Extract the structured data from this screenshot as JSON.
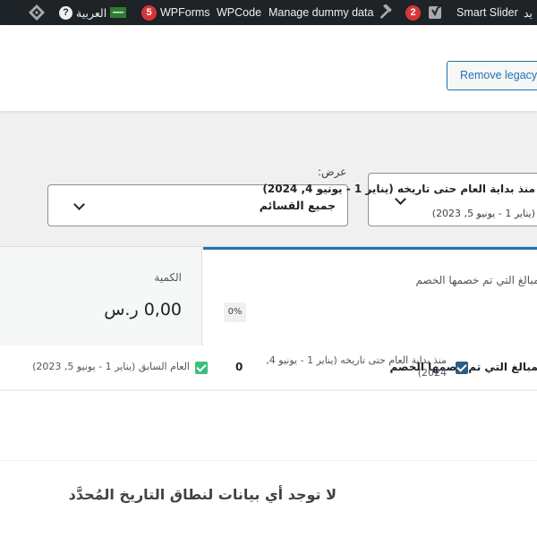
{
  "admin_bar": {
    "left_fragment": "يد",
    "smart_slider": "Smart Slider",
    "updates_count": "2",
    "manage_dummy_data": "Manage dummy data",
    "wpcode": "WPCode",
    "wpforms": "WPForms",
    "wpforms_count": "5",
    "language": "العربية",
    "help_icon": "?"
  },
  "header": {
    "legacy_button_label": "Remove legacy reports"
  },
  "filters": {
    "view_label": "عرض:",
    "category_value": "جميع القسائم",
    "date_range_value": "منذ بداية العام حتى تاريخه (يناير 1 - يونيو 4, 2024)",
    "date_compare_value": "(يناير 1 - يونيو 5, 2023)"
  },
  "cards": {
    "discount": {
      "label": "المبالغ التي تم خصمها الخصم",
      "percent": "0%"
    },
    "amount": {
      "label": "الكمية",
      "value": "0,00 ر.س"
    }
  },
  "legend": {
    "metric": "المبالغ التي تم خصمها الخصم",
    "current_period": "منذ بداية العام حتى تاريخه (يناير 1 - يونيو 4, 2024)",
    "current_value": "0",
    "previous_period": "العام السابق (يناير 1 - يونيو 5, 2023)"
  },
  "chart": {
    "empty_message": "لا توجد أي بيانات لنطاق التاريخ المُحدَّد"
  },
  "colors": {
    "admin_bar": "#1d2327",
    "accent": "#2271b1",
    "badge_red": "#d63638",
    "current_series": "#2c5d84",
    "previous_series": "#3ac07a"
  }
}
